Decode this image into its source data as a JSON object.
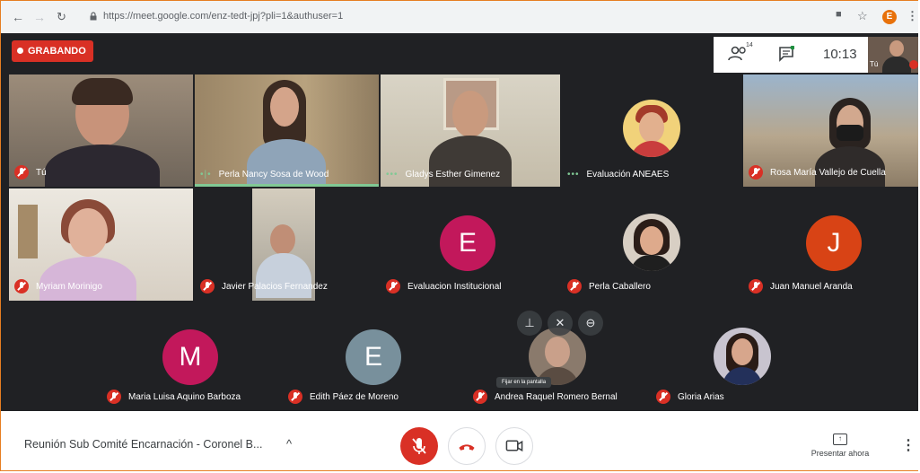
{
  "browser": {
    "url": "https://meet.google.com/enz-tedt-jpj?pli=1&authuser=1",
    "back_icon": "arrow-left-icon",
    "forward_icon": "arrow-right-icon",
    "reload_icon": "reload-icon",
    "profile_initial": "E"
  },
  "meet": {
    "recording_label": "GRABANDO",
    "participant_count": "14",
    "clock": "10:13",
    "self_label": "Tú"
  },
  "participants": [
    {
      "name": "Tú",
      "muted": true
    },
    {
      "name": "Perla Nancy Sosa de Wood",
      "muted": false,
      "speaking": true
    },
    {
      "name": "Gladys Esther Gimenez",
      "muted": false
    },
    {
      "name": "Evaluación ANEAES",
      "muted": false
    },
    {
      "name": "Rosa María Vallejo de Cuella",
      "muted": true
    },
    {
      "name": "Myriam Morinigo",
      "muted": true
    },
    {
      "name": "Javier Palacios Fernandez",
      "muted": true
    },
    {
      "name": "Evaluacion Institucional",
      "muted": true,
      "initial": "E",
      "color": "#c2185b"
    },
    {
      "name": "Perla Caballero",
      "muted": true
    },
    {
      "name": "Juan Manuel Aranda",
      "muted": true,
      "initial": "J",
      "color": "#d84315"
    },
    {
      "name": "Maria Luisa Aquino Barboza",
      "muted": true,
      "initial": "M",
      "color": "#c2185b"
    },
    {
      "name": "Edith Páez de Moreno",
      "muted": true,
      "initial": "E",
      "color": "#78909c"
    },
    {
      "name": "Andrea Raquel Romero Bernal",
      "muted": true
    },
    {
      "name": "Gloria Arias",
      "muted": true
    }
  ],
  "tooltip": "Fijar en la pantalla",
  "bottom": {
    "meeting_name": "Reunión Sub Comité Encarnación - Coronel B...",
    "present_label": "Presentar ahora"
  },
  "colors": {
    "accent_red": "#d93025",
    "meet_bg": "#202124",
    "speaking_green": "#81c995"
  }
}
